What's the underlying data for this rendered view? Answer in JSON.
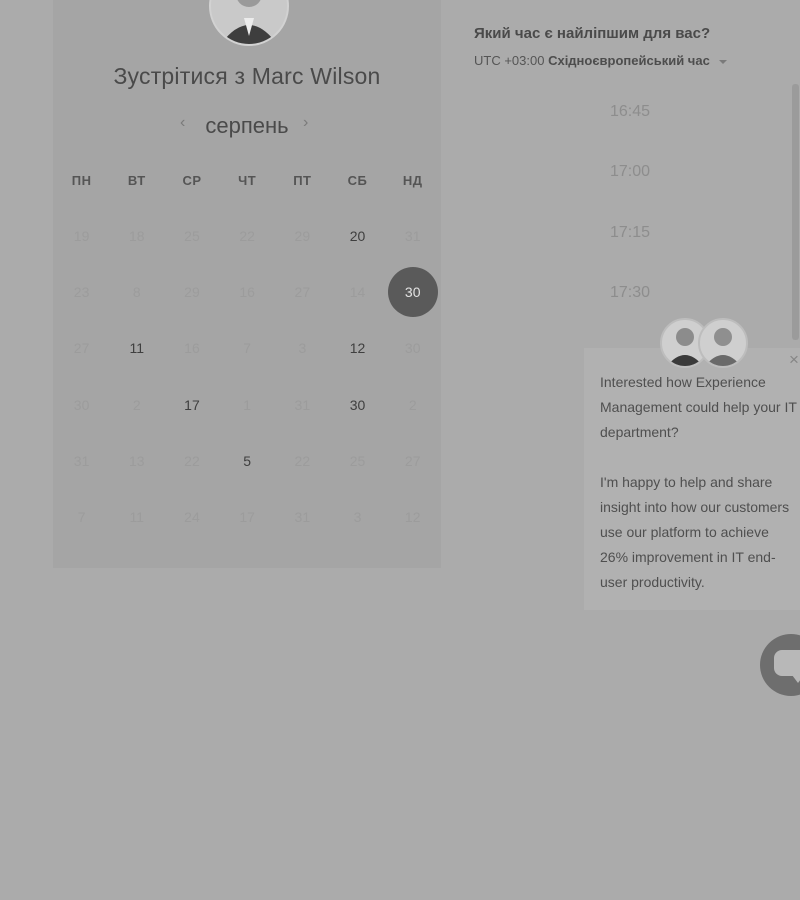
{
  "booking": {
    "title": "Зустрітися з Marc Wilson",
    "month": "серпень",
    "weekdays": [
      "ПН",
      "ВТ",
      "СР",
      "ЧТ",
      "ПТ",
      "СБ",
      "НД"
    ],
    "days": [
      {
        "label": "19",
        "state": "dim"
      },
      {
        "label": "18",
        "state": "dim"
      },
      {
        "label": "25",
        "state": "dim"
      },
      {
        "label": "22",
        "state": "dim"
      },
      {
        "label": "29",
        "state": "dim"
      },
      {
        "label": "20",
        "state": "available"
      },
      {
        "label": "31",
        "state": "dim"
      },
      {
        "label": "23",
        "state": "dim"
      },
      {
        "label": "8",
        "state": "dim"
      },
      {
        "label": "29",
        "state": "dim"
      },
      {
        "label": "16",
        "state": "dim"
      },
      {
        "label": "27",
        "state": "dim"
      },
      {
        "label": "14",
        "state": "dim"
      },
      {
        "label": "30",
        "state": "selected"
      },
      {
        "label": "27",
        "state": "dim"
      },
      {
        "label": "11",
        "state": "available"
      },
      {
        "label": "16",
        "state": "dim"
      },
      {
        "label": "7",
        "state": "dim"
      },
      {
        "label": "3",
        "state": "dim"
      },
      {
        "label": "12",
        "state": "available"
      },
      {
        "label": "30",
        "state": "dim"
      },
      {
        "label": "30",
        "state": "dim"
      },
      {
        "label": "2",
        "state": "dim"
      },
      {
        "label": "17",
        "state": "available"
      },
      {
        "label": "1",
        "state": "dim"
      },
      {
        "label": "31",
        "state": "dim"
      },
      {
        "label": "30",
        "state": "available"
      },
      {
        "label": "2",
        "state": "dim"
      },
      {
        "label": "31",
        "state": "dim"
      },
      {
        "label": "13",
        "state": "dim"
      },
      {
        "label": "22",
        "state": "dim"
      },
      {
        "label": "5",
        "state": "available"
      },
      {
        "label": "22",
        "state": "dim"
      },
      {
        "label": "25",
        "state": "dim"
      },
      {
        "label": "27",
        "state": "dim"
      },
      {
        "label": "7",
        "state": "dim"
      },
      {
        "label": "11",
        "state": "dim"
      },
      {
        "label": "24",
        "state": "dim"
      },
      {
        "label": "17",
        "state": "dim"
      },
      {
        "label": "31",
        "state": "dim"
      },
      {
        "label": "3",
        "state": "dim"
      },
      {
        "label": "12",
        "state": "dim"
      }
    ]
  },
  "time_panel": {
    "question": "Який час є найліпшим для вас?",
    "tz_offset": "UTC +03:00",
    "tz_name": "Східноєвропейський час",
    "slots": [
      "16:45",
      "17:00",
      "17:15",
      "17:30"
    ]
  },
  "chat_popup": {
    "paragraph1": "Interested how Experience Management could help your IT department?",
    "paragraph2": "I'm happy to help and share insight into how our customers use our platform to achieve 26% improvement in IT end-user productivity."
  },
  "icons": {
    "prev": "‹",
    "next": "›",
    "close": "×"
  }
}
